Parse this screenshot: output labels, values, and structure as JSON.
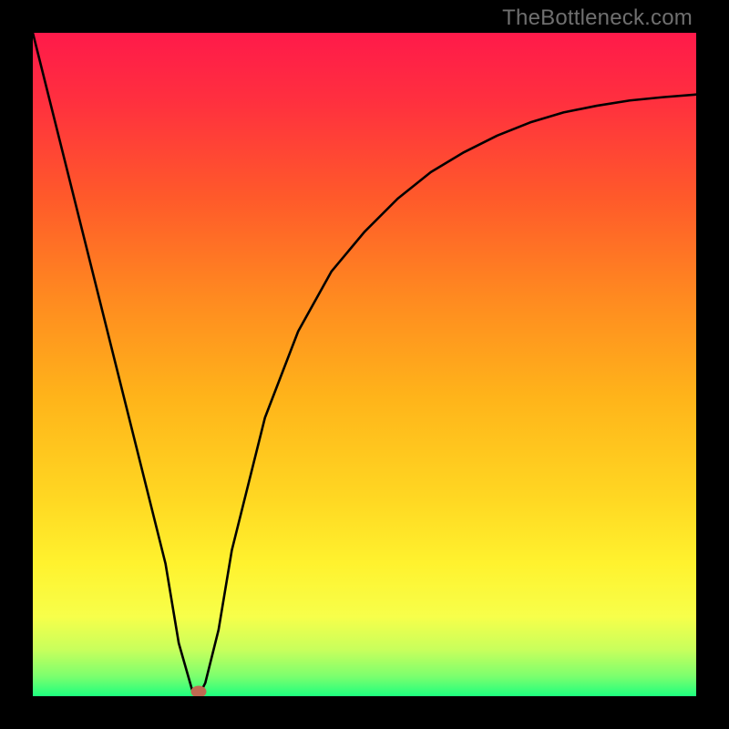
{
  "watermark": "TheBottleneck.com",
  "colors": {
    "border": "#000000",
    "curve": "#000000",
    "marker_fill": "#c06a52",
    "gradient_stops": [
      {
        "offset": 0.0,
        "color": "#ff1a4a"
      },
      {
        "offset": 0.1,
        "color": "#ff2f3f"
      },
      {
        "offset": 0.25,
        "color": "#ff5a2a"
      },
      {
        "offset": 0.4,
        "color": "#ff8a20"
      },
      {
        "offset": 0.55,
        "color": "#ffb41a"
      },
      {
        "offset": 0.7,
        "color": "#ffd722"
      },
      {
        "offset": 0.8,
        "color": "#fff22e"
      },
      {
        "offset": 0.88,
        "color": "#f7ff4a"
      },
      {
        "offset": 0.93,
        "color": "#c8ff5c"
      },
      {
        "offset": 0.97,
        "color": "#7cff6e"
      },
      {
        "offset": 1.0,
        "color": "#1eff7e"
      }
    ]
  },
  "chart_data": {
    "type": "line",
    "title": "",
    "xlabel": "",
    "ylabel": "",
    "xlim": [
      0,
      100
    ],
    "ylim": [
      0,
      100
    ],
    "series": [
      {
        "name": "bottleneck-curve",
        "x": [
          0,
          5,
          10,
          15,
          20,
          22,
          24,
          25,
          26,
          28,
          30,
          35,
          40,
          45,
          50,
          55,
          60,
          65,
          70,
          75,
          80,
          85,
          90,
          95,
          100
        ],
        "y": [
          100,
          80,
          60,
          40,
          20,
          8,
          1,
          0,
          2,
          10,
          22,
          42,
          55,
          64,
          70,
          75,
          79,
          82,
          84.5,
          86.5,
          88,
          89,
          89.8,
          90.3,
          90.7
        ]
      }
    ],
    "annotations": [
      {
        "name": "min-marker",
        "x": 25,
        "y": 0
      }
    ],
    "legend": false,
    "grid": false
  }
}
